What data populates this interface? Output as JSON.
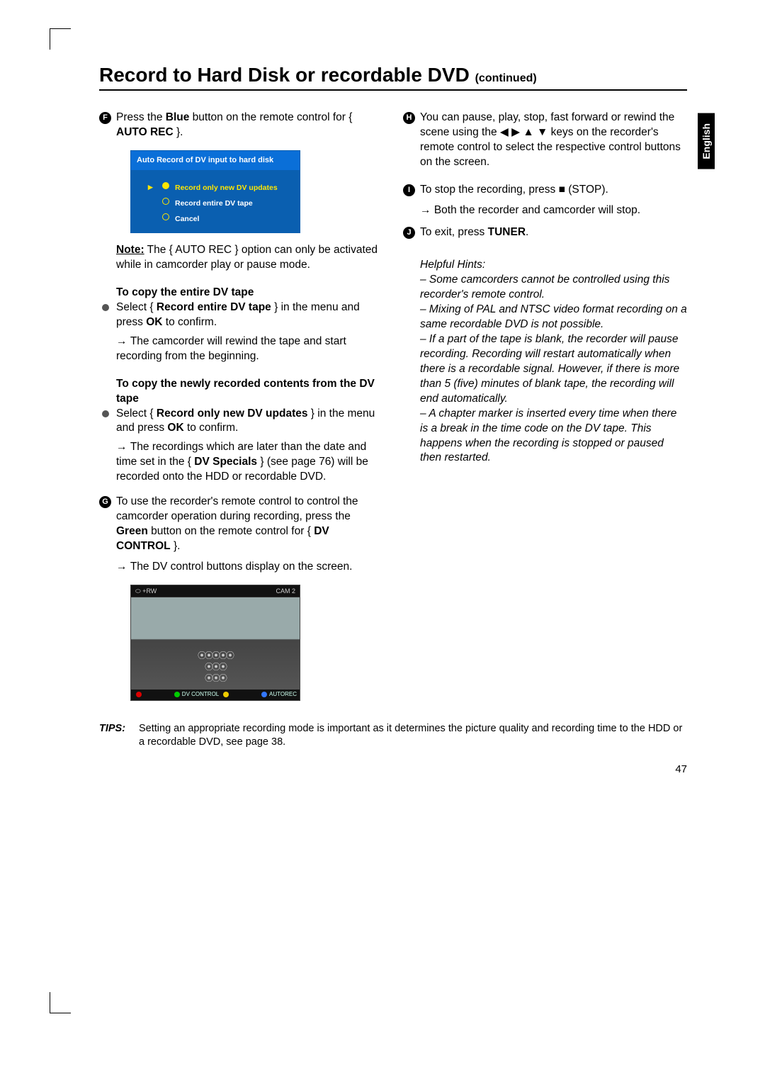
{
  "page": {
    "title_main": "Record to Hard Disk or recordable DVD",
    "title_cont": "(continued)",
    "language_tab": "English",
    "page_number": "47"
  },
  "left": {
    "s6_a": "Press the ",
    "s6_blue": "Blue",
    "s6_b": " button on the remote control for { ",
    "s6_autorec": "AUTO REC",
    "s6_c": " }.",
    "menu": {
      "header": "Auto Record of DV input to hard disk",
      "opt1": "Record only new DV updates",
      "opt2": "Record entire DV tape",
      "opt3": "Cancel"
    },
    "note_lbl": "Note:",
    "note_body": "  The { AUTO REC } option can only be activated while in camcorder play or pause mode.",
    "h1": "To copy the entire DV tape",
    "b1_a": "Select { ",
    "b1_bold": "Record entire DV tape",
    "b1_b": " } in the menu and press ",
    "b1_ok": "OK",
    "b1_c": " to confirm.",
    "b1_arrow": "The camcorder will rewind the tape and start recording from the beginning.",
    "h2": "To copy the newly recorded contents from the DV tape",
    "b2_a": "Select { ",
    "b2_bold": "Record only new DV updates",
    "b2_b": " } in the menu and press ",
    "b2_ok": "OK",
    "b2_c": " to confirm.",
    "b2_arrow_a": "The recordings which are later than the date and time set in the { ",
    "b2_arrow_bold": "DV Specials",
    "b2_arrow_b": " } (see page 76) will be recorded onto the HDD or recordable DVD.",
    "s7_a": "To use the recorder's remote control to control the camcorder operation during recording, press the ",
    "s7_green": "Green",
    "s7_b": " button on the remote control for { ",
    "s7_dv": "DV CONTROL",
    "s7_c": " }.",
    "s7_arrow": "The DV control buttons display on the screen.",
    "screen": {
      "tl": "⬭ +RW",
      "tr": "CAM 2",
      "row1": "⦿⦿⦿⦿⦿",
      "row2": "⦿⦿⦿",
      "row3": "⦿⦿⦿",
      "bot_dvc": "DV CONTROL",
      "bot_ar": "AUTOREC"
    }
  },
  "right": {
    "s8_a": "You can pause, play, stop, fast forward or rewind the scene using the ",
    "s8_keys": "◀ ▶ ▲ ▼",
    "s8_b": " keys on the recorder's remote control to select the respective control buttons on the screen.",
    "s9_a": "To stop the recording, press ",
    "s9_stop": "■",
    "s9_b": " (STOP).",
    "s9_arrow": "Both the recorder and camcorder will stop.",
    "s10_a": "To exit, press ",
    "s10_tuner": "TUNER",
    "s10_b": ".",
    "hints_head": "Helpful Hints:",
    "hint1": "–  Some camcorders cannot be controlled using this recorder's remote control.",
    "hint2": "–  Mixing of PAL and NTSC video format recording on a same recordable DVD is not possible.",
    "hint3": "–  If a part of the tape is blank, the recorder will pause recording. Recording will restart automatically when there is a recordable signal. However, if there is more than 5 (five) minutes of blank tape, the recording will end automatically.",
    "hint4": "–  A chapter marker is inserted every time when there is a break in the time code on the DV tape. This happens when the recording is stopped or paused then restarted."
  },
  "tips": {
    "label": "TIPS:",
    "body": "Setting an appropriate recording mode is important as it determines the picture quality and recording time to the HDD or a recordable DVD, see page 38."
  }
}
